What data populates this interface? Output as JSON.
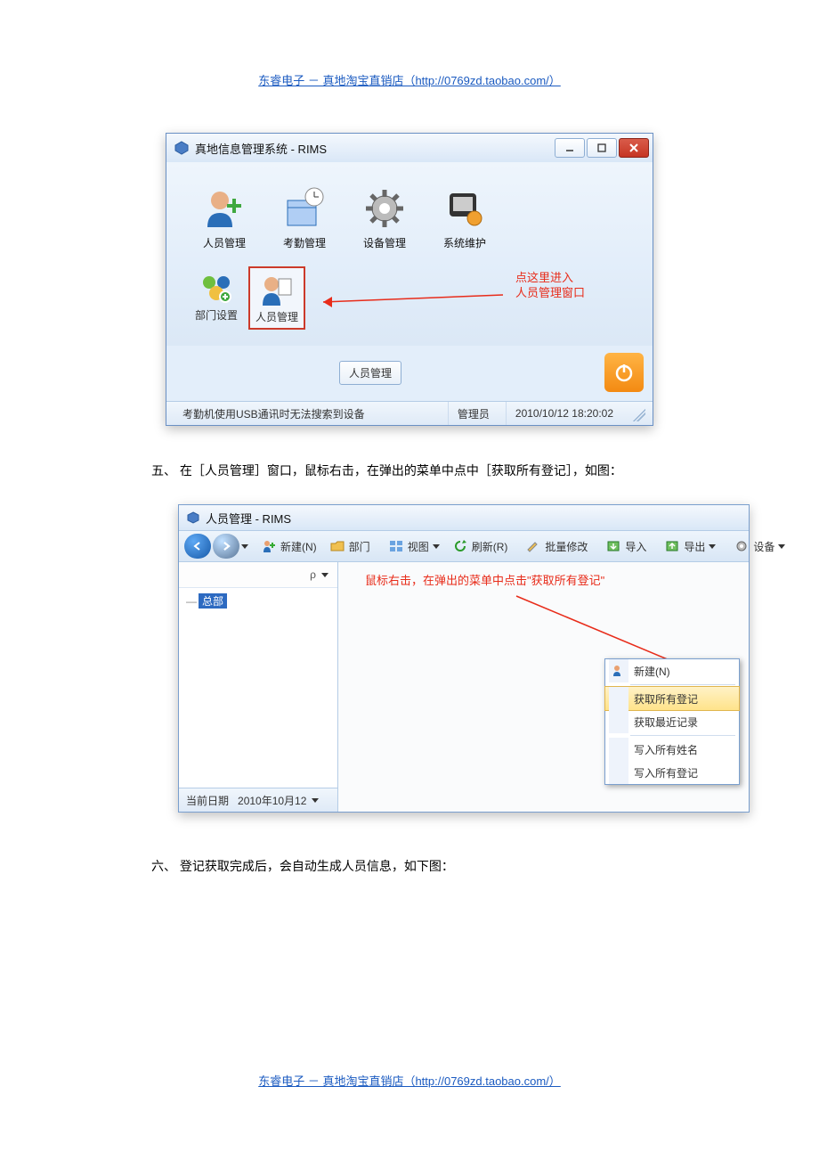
{
  "page_header": "东睿电子 － 真地淘宝直销店（http://0769zd.taobao.com/）",
  "page_footer": "东睿电子 － 真地淘宝直销店（http://0769zd.taobao.com/）",
  "screenshot1": {
    "window_title": "真地信息管理系统 - RIMS",
    "toolbar": {
      "items": [
        {
          "label": "人员管理"
        },
        {
          "label": "考勤管理"
        },
        {
          "label": "设备管理"
        },
        {
          "label": "系统维护"
        }
      ],
      "subitems": [
        {
          "label": "部门设置"
        },
        {
          "label": "人员管理"
        }
      ]
    },
    "annotation": {
      "line1": "点这里进入",
      "line2": "人员管理窗口"
    },
    "tooltip_label": "人员管理",
    "statusbar": {
      "message": "考勤机使用USB通讯时无法搜索到设备",
      "user": "管理员",
      "datetime": "2010/10/12 18:20:02"
    }
  },
  "instruction5": "五、 在［人员管理］窗口，鼠标右击，在弹出的菜单中点中［获取所有登记］，如图：",
  "screenshot2": {
    "window_title": "人员管理 - RIMS",
    "toolbar": {
      "new": "新建(N)",
      "dept": "部门",
      "view": "视图",
      "refresh": "刷新(R)",
      "batch": "批量修改",
      "import": "导入",
      "export": "导出",
      "device": "设备"
    },
    "search_hint": "ρ",
    "tree_root": "总部",
    "annotation": "鼠标右击，在弹出的菜单中点击\"获取所有登记\"",
    "context_menu": {
      "new": "新建(N)",
      "get_all_reg": "获取所有登记",
      "get_recent": "获取最近记录",
      "write_names": "写入所有姓名",
      "write_all_reg": "写入所有登记"
    },
    "bottombar": {
      "label": "当前日期",
      "value": "2010年10月12"
    }
  },
  "instruction6": "六、 登记获取完成后，会自动生成人员信息，如下图："
}
